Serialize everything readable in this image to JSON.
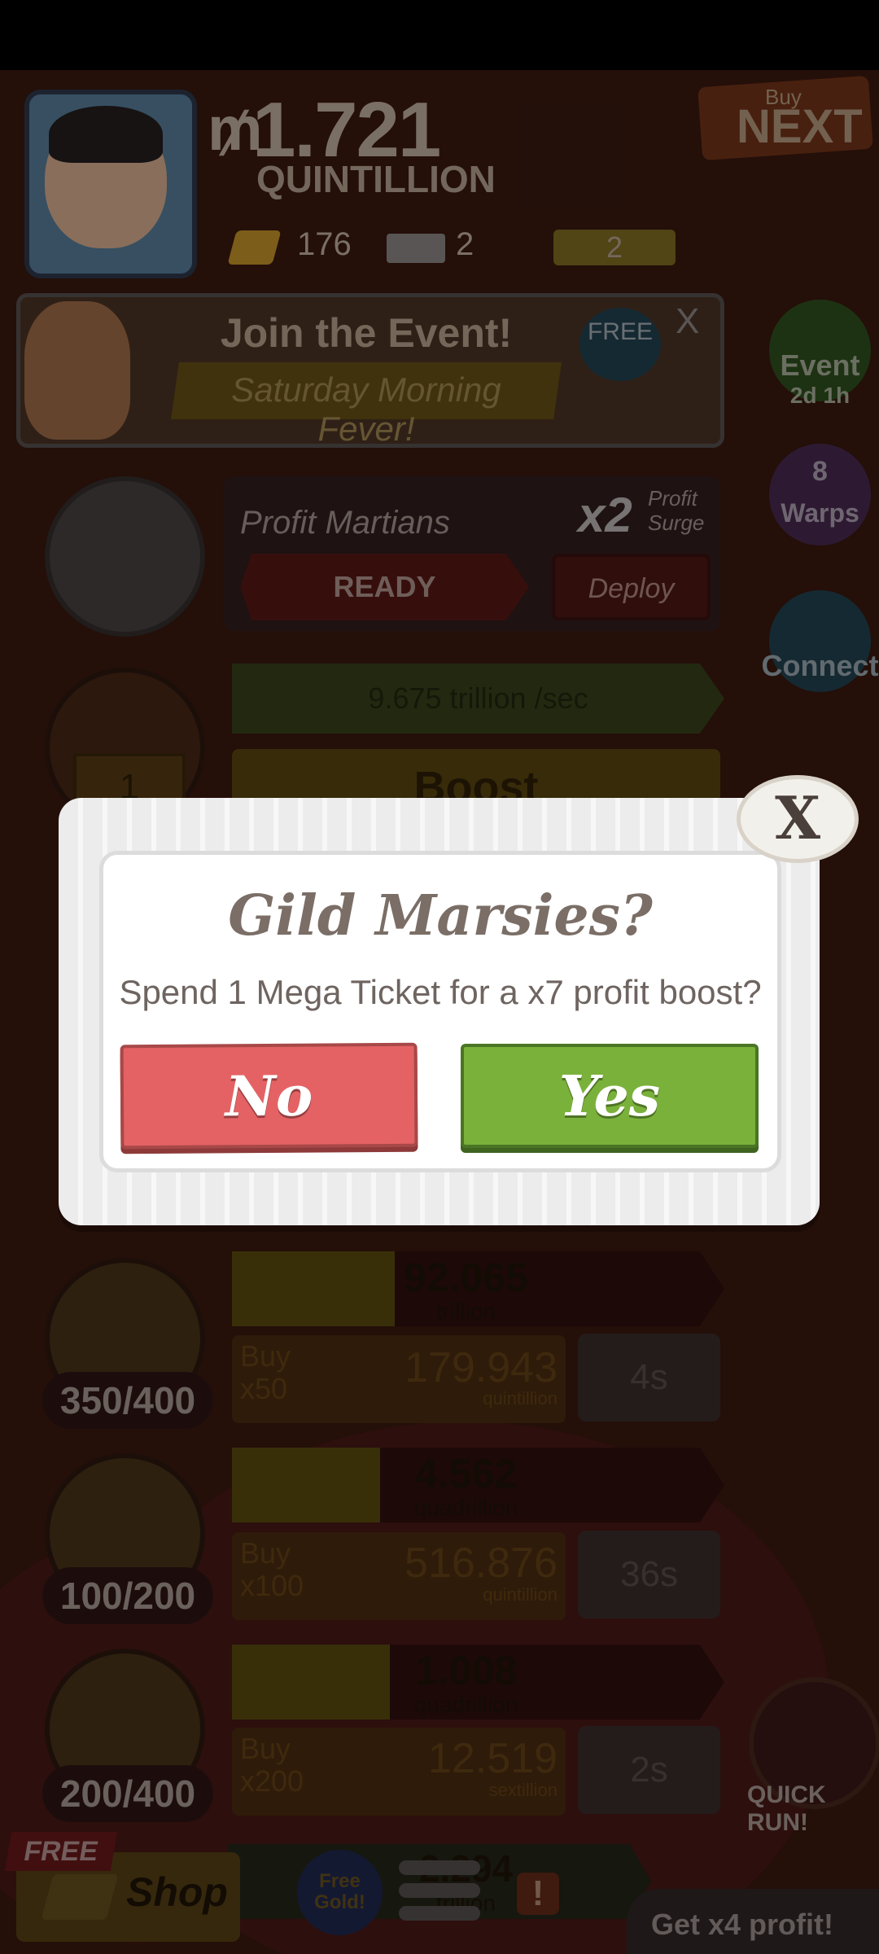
{
  "header": {
    "currency_symbol": "₥",
    "money_amount": "1.721",
    "money_unit": "QUINTILLION",
    "gold_count": "176",
    "mega_ticket_count": "2",
    "super_ticket_count": "2",
    "buy_label": "Buy",
    "next_label": "NEXT"
  },
  "event_banner": {
    "title": "Join the Event!",
    "subtitle": "Saturday Morning Fever!",
    "free_label": "FREE",
    "close_label": "X"
  },
  "side_buttons": [
    {
      "label": "Event",
      "sub": "2d 1h",
      "icon": "event-hat-icon",
      "color": "#2d5a20",
      "text_color": "#b8c8b0"
    },
    {
      "label": "Warps",
      "sub": "8",
      "icon": "warps-icon",
      "color": "#4a2e5a",
      "text_color": "#c0b8cc"
    },
    {
      "label": "Connect",
      "sub": "",
      "icon": "connect-icon",
      "color": "#1e4a5a",
      "text_color": "#a8c0c8"
    }
  ],
  "martians_card": {
    "name": "Profit Martians",
    "multiplier": "x2",
    "surge_line1": "Profit",
    "surge_line2": "Surge",
    "status": "READY",
    "deploy_label": "Deploy"
  },
  "top_business": {
    "rate": "9.675 trillion /sec",
    "boost_label": "Boost",
    "ticket_count": "1"
  },
  "businesses": [
    {
      "profit": "92.065",
      "profit_unit": "trillion",
      "fill": 0.33,
      "count": "350/400",
      "buy_label": "Buy",
      "buy_qty": "x50",
      "cost": "179.943",
      "cost_unit": "quintillion",
      "time": "4s",
      "icon": "ladybug-icon"
    },
    {
      "profit": "4.562",
      "profit_unit": "quadrillion",
      "fill": 0.3,
      "count": "100/200",
      "buy_label": "Buy",
      "buy_qty": "x100",
      "cost": "516.876",
      "cost_unit": "quintillion",
      "time": "36s",
      "icon": "coin-icon"
    },
    {
      "profit": "1.008",
      "profit_unit": "quadrillion",
      "fill": 0.32,
      "count": "200/400",
      "buy_label": "Buy",
      "buy_qty": "x200",
      "cost": "12.519",
      "cost_unit": "sextillion",
      "time": "2s",
      "icon": "heart-character-icon"
    }
  ],
  "bottom_partial": {
    "profit": "2.294",
    "profit_unit": "trillion"
  },
  "bottom_bar": {
    "shop_free": "FREE",
    "shop_label": "Shop",
    "free_gold_label": "Free Gold!",
    "alert_label": "!",
    "quick_run_label": "QUICK RUN!",
    "x4_label": "Get x4 profit!"
  },
  "dialog": {
    "title": "Gild Marsies?",
    "message": "Spend 1 Mega Ticket for a x7 profit boost?",
    "no_label": "No",
    "yes_label": "Yes",
    "close_label": "X"
  }
}
